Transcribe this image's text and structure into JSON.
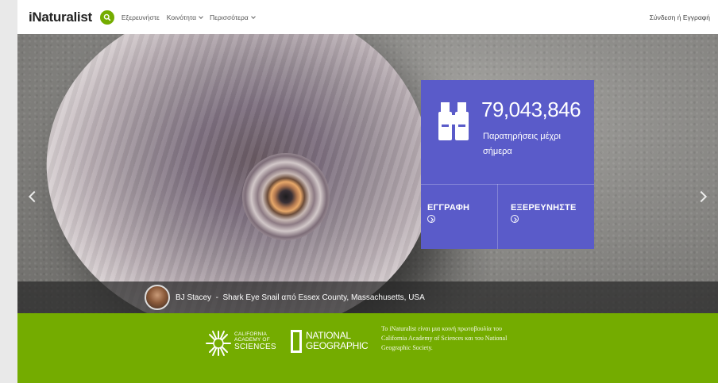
{
  "header": {
    "logo_text": "iNaturalist",
    "nav": [
      {
        "label": "Εξερευνήστε",
        "dropdown": false
      },
      {
        "label": "Κοινότητα",
        "dropdown": true
      },
      {
        "label": "Περισσότερα",
        "dropdown": true
      }
    ],
    "login_label": "Σύνδεση ή Εγγραφή"
  },
  "hero": {
    "stats": {
      "count": "79,043,846",
      "label": "Παρατηρήσεις μέχρι σήμερα",
      "icon": "binoculars-icon"
    },
    "cta": {
      "signup_label": "ΕΓΓΡΑΦΗ",
      "explore_label": "ΕΞΕΡΕΥΝΗΣΤΕ"
    },
    "caption": {
      "author": "BJ Stacey",
      "separator": "-",
      "text": "Shark Eye Snail από Essex County, Massachusetts, USA"
    }
  },
  "footer": {
    "cas_logo_lines": [
      "CALIFORNIA",
      "ACADEMY OF",
      "SCIENCES"
    ],
    "natgeo_lines": [
      "NATIONAL",
      "GEOGRAPHIC"
    ],
    "description": "Το iNaturalist είναι μια κοινή πρωτοβουλία του California Academy of Sciences και του National Geographic Society."
  },
  "colors": {
    "brand_green": "#74ac00",
    "stats_purple": "#5a5bc9"
  }
}
